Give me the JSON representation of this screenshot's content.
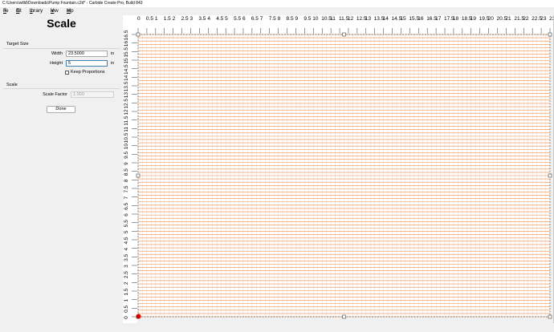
{
  "window": {
    "title": "C:\\Users\\willd\\Downloads\\Pump Fountain.c2d* - Carbide Create Pro, Build 843"
  },
  "menu": {
    "items": [
      {
        "label": "File",
        "accel": "F"
      },
      {
        "label": "Edit",
        "accel": "E"
      },
      {
        "label": "Library",
        "accel": "L"
      },
      {
        "label": "View",
        "accel": "V"
      },
      {
        "label": "Help",
        "accel": "H"
      }
    ]
  },
  "panel": {
    "title": "Scale",
    "target_size": {
      "heading": "Target Size",
      "width_label": "Width",
      "width_value": "23.5000",
      "width_unit": "in",
      "height_label": "Height",
      "height_value": "5",
      "height_unit": "in",
      "keep_proportions_label": "Keep Proportions",
      "keep_proportions_checked": false
    },
    "scale": {
      "heading": "Scale",
      "factor_label": "Scale Factor",
      "factor_value": "1.000"
    },
    "done_label": "Done"
  },
  "canvas": {
    "x_ruler_labels": [
      "0",
      "0.5",
      "1",
      "1.5",
      "2",
      "2.5",
      "3",
      "3.5",
      "4",
      "4.5",
      "5",
      "5.5",
      "6",
      "6.5",
      "7",
      "7.5",
      "8",
      "8.5",
      "9",
      "9.5",
      "10",
      "10.5",
      "11",
      "11.5",
      "12",
      "12.5",
      "13",
      "13.5",
      "14",
      "14.5",
      "15",
      "15.5",
      "16",
      "16.5",
      "17",
      "17.5",
      "18",
      "18.5",
      "19",
      "19.5",
      "20",
      "20.5",
      "21",
      "21.5",
      "22",
      "22.5",
      "23",
      "23.5"
    ],
    "y_ruler_labels": [
      "0",
      "0.5",
      "1",
      "1.5",
      "2",
      "2.5",
      "3",
      "3.5",
      "4",
      "4.5",
      "5",
      "5.5",
      "6",
      "6.5",
      "7",
      "7.5",
      "8",
      "8.5",
      "9",
      "9.5",
      "10",
      "10.5",
      "11",
      "11.5",
      "12",
      "12.5",
      "13",
      "13.5",
      "14",
      "14.5",
      "15",
      "15.5",
      "16",
      "16.5"
    ],
    "stock_width_in": 23.5,
    "stock_height_in": 16.5,
    "colors": {
      "background": "#ffffff",
      "grid_line": "#e0e0e0",
      "toolpath_line": "#f28a3d",
      "selection_box": "#555555",
      "origin_marker": "#cc0000"
    }
  }
}
